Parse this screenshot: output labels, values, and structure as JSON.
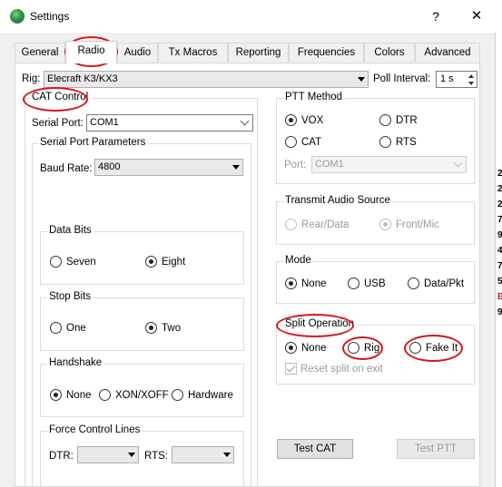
{
  "window": {
    "title": "Settings",
    "help_glyph": "?",
    "close_glyph": "✕"
  },
  "tabs": [
    "General",
    "Radio",
    "Audio",
    "Tx Macros",
    "Reporting",
    "Frequencies",
    "Colors",
    "Advanced"
  ],
  "active_tab": "Radio",
  "rig": {
    "label": "Rig:",
    "value": "Elecraft K3/KX3"
  },
  "poll": {
    "label": "Poll Interval:",
    "value": "1 s"
  },
  "cat_control": {
    "title": "CAT Control",
    "serial_port_label": "Serial Port:",
    "serial_port_value": "COM1",
    "params_title": "Serial Port Parameters",
    "baud_label": "Baud Rate:",
    "baud_value": "4800",
    "data_bits": {
      "title": "Data Bits",
      "options": [
        "Seven",
        "Eight"
      ]
    },
    "stop_bits": {
      "title": "Stop Bits",
      "options": [
        "One",
        "Two"
      ]
    },
    "handshake": {
      "title": "Handshake",
      "options": [
        "None",
        "XON/XOFF",
        "Hardware"
      ]
    },
    "force_lines": {
      "title": "Force Control Lines",
      "dtr_label": "DTR:",
      "rts_label": "RTS:"
    }
  },
  "ptt_method": {
    "title": "PTT Method",
    "options": [
      "VOX",
      "DTR",
      "CAT",
      "RTS"
    ],
    "port_label": "Port:",
    "port_value": "COM1"
  },
  "transmit_audio": {
    "title": "Transmit Audio Source",
    "options": [
      "Rear/Data",
      "Front/Mic"
    ]
  },
  "mode": {
    "title": "Mode",
    "options": [
      "None",
      "USB",
      "Data/Pkt"
    ]
  },
  "split": {
    "title": "Split Operation",
    "options": [
      "None",
      "Rig",
      "Fake It"
    ],
    "reset_label": "Reset split on exit"
  },
  "buttons": {
    "test_cat": "Test CAT",
    "test_ptt": "Test PTT"
  },
  "behind_window_chars": [
    "2",
    "2",
    "2",
    "7",
    "9",
    "4",
    "7",
    "5",
    "E",
    "9"
  ],
  "colors": {
    "annotation": "#d8141c"
  }
}
